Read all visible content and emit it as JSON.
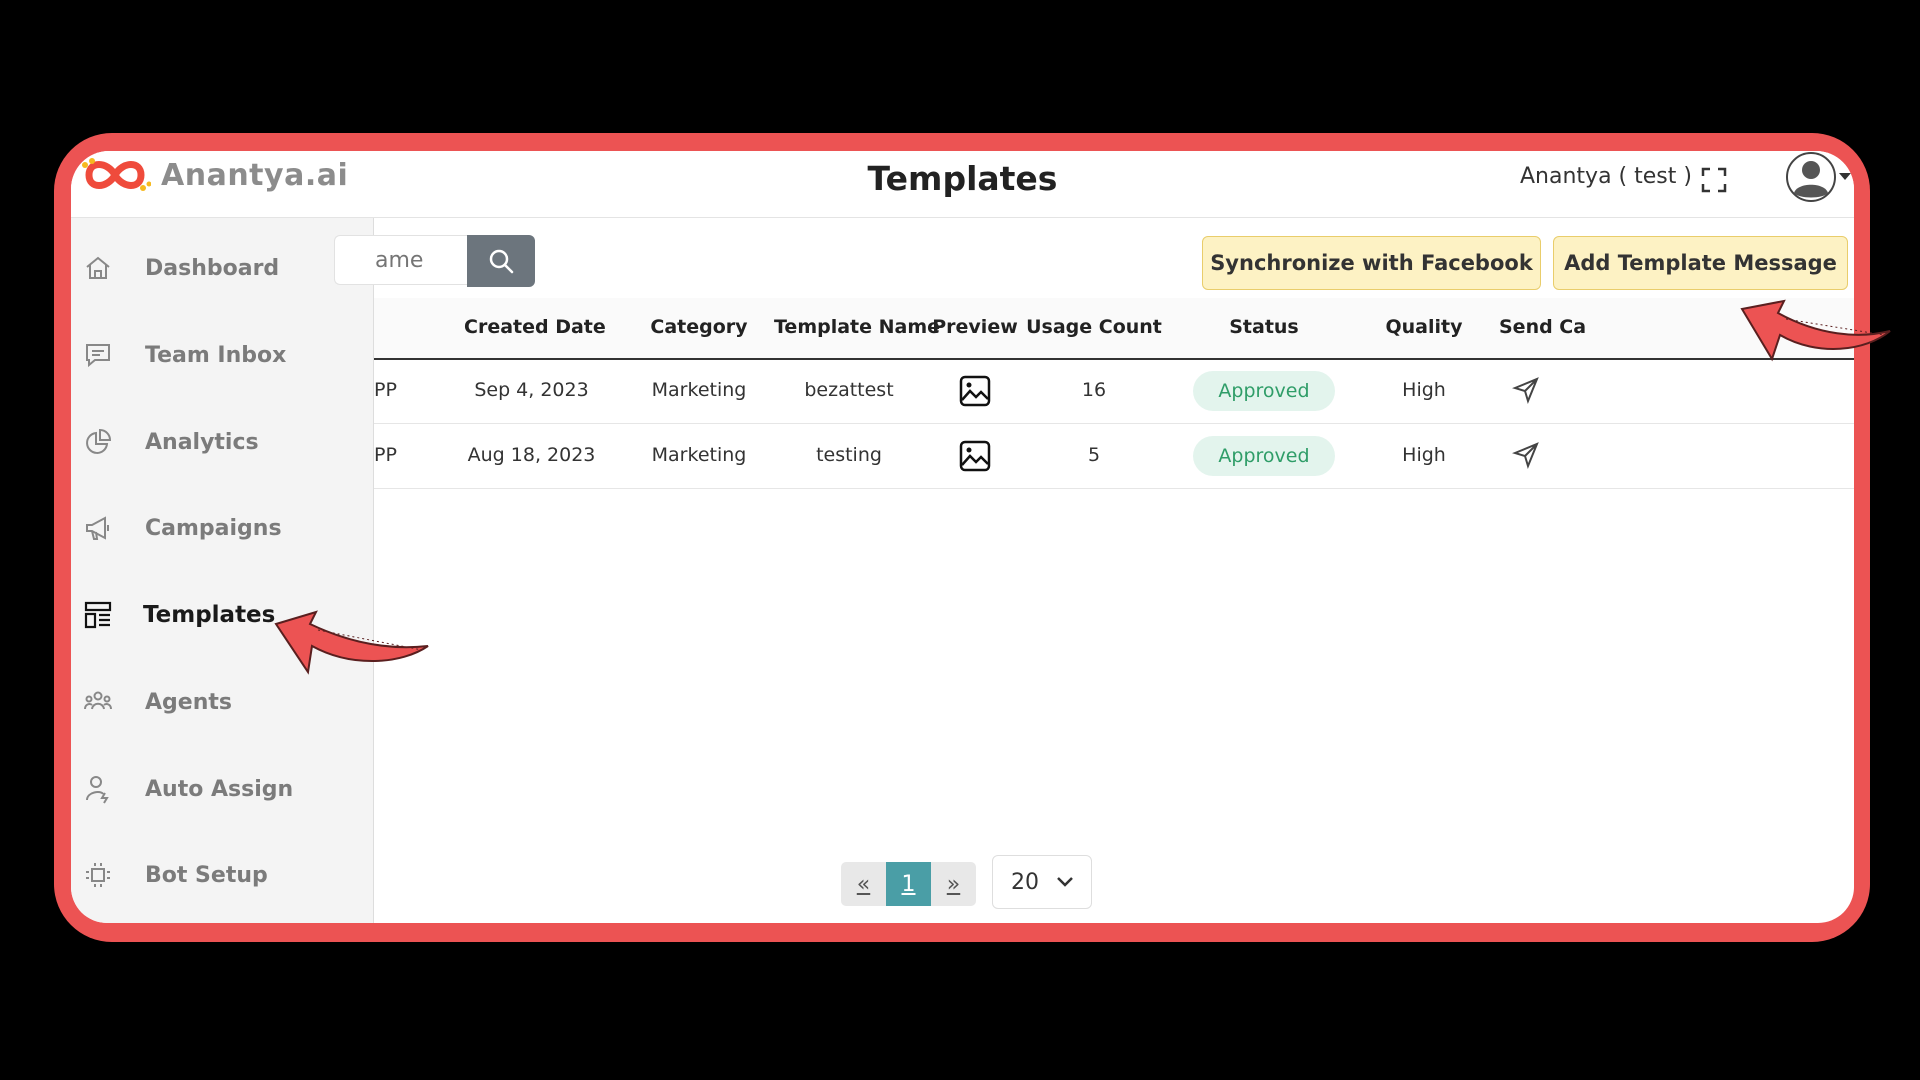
{
  "app": {
    "logo_text": "Anantya.ai",
    "page_title": "Templates",
    "account_name": "Anantya ( test )"
  },
  "sidebar": {
    "items": [
      {
        "label": "Dashboard",
        "icon": "home-icon"
      },
      {
        "label": "Team Inbox",
        "icon": "chat-icon"
      },
      {
        "label": "Analytics",
        "icon": "pie-chart-icon"
      },
      {
        "label": "Campaigns",
        "icon": "megaphone-icon"
      },
      {
        "label": "Templates",
        "icon": "templates-icon",
        "active": true
      },
      {
        "label": "Agents",
        "icon": "users-icon"
      },
      {
        "label": "Auto Assign",
        "icon": "user-bolt-icon"
      },
      {
        "label": "Bot Setup",
        "icon": "bot-icon"
      }
    ]
  },
  "toolbar": {
    "search_placeholder": "ame",
    "sync_label": "Synchronize with Facebook",
    "add_label": "Add Template Message"
  },
  "table": {
    "columns": [
      "Created Date",
      "Category",
      "Template Name",
      "Preview",
      "Usage Count",
      "Status",
      "Quality",
      "Send Ca"
    ],
    "rows": [
      {
        "prefix": "PP",
        "created": "Sep 4, 2023",
        "category": "Marketing",
        "name": "bezattest",
        "usage": "16",
        "status": "Approved",
        "quality": "High"
      },
      {
        "prefix": "PP",
        "created": "Aug 18, 2023",
        "category": "Marketing",
        "name": "testing",
        "usage": "5",
        "status": "Approved",
        "quality": "High"
      }
    ]
  },
  "pagination": {
    "prev": "«",
    "current": "1",
    "next": "»",
    "page_size": "20"
  },
  "colors": {
    "frame": "#ec5353",
    "accent_teal": "#4a9ea6",
    "approved_bg": "#e3f4ed",
    "approved_text": "#2f9d68",
    "button_yellow": "#fdf2c4"
  }
}
